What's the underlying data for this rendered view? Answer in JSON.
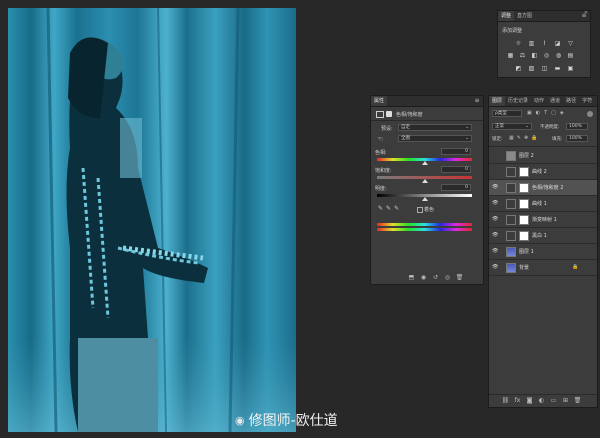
{
  "adjustments_panel": {
    "tabs": [
      "调整",
      "直方图"
    ],
    "subtitle": "添加调整",
    "icons_row1": [
      "brightness-contrast-icon",
      "levels-icon",
      "curves-icon",
      "exposure-icon",
      "vibrance-icon"
    ],
    "icons_row2": [
      "hue-saturation-icon",
      "color-balance-icon",
      "black-white-icon",
      "photo-filter-icon",
      "channel-mixer-icon",
      "color-lookup-icon"
    ],
    "icons_row3": [
      "invert-icon",
      "posterize-icon",
      "threshold-icon",
      "gradient-map-icon",
      "selective-color-icon"
    ]
  },
  "properties_panel": {
    "tab": "属性",
    "title": "色相/饱和度",
    "preset_label": "预设:",
    "preset_value": "自定",
    "channel_value": "全图",
    "hue_label": "色相:",
    "hue_value": "0",
    "hue_level": 0.5,
    "saturation_label": "饱和度:",
    "saturation_value": "0",
    "saturation_level": 0.5,
    "lightness_label": "明度:",
    "lightness_value": "0",
    "lightness_level": 0.5,
    "colorize_label": "着色"
  },
  "layers_panel": {
    "tabs": [
      "图层",
      "历史记录",
      "动作",
      "通道",
      "路径",
      "字符"
    ],
    "filter_kind": "ρ类型",
    "blend_mode": "正常",
    "opacity_label": "不透明度:",
    "opacity_value": "100%",
    "lock_label": "锁定:",
    "fill_label": "填充:",
    "fill_value": "100%",
    "layers": [
      {
        "name": "图层 2",
        "visible": false,
        "kind": "pixel",
        "selected": false
      },
      {
        "name": "曲线 2",
        "visible": false,
        "kind": "adjustment",
        "selected": false
      },
      {
        "name": "色相/饱和度 2",
        "visible": true,
        "kind": "adjustment",
        "selected": true
      },
      {
        "name": "曲线 1",
        "visible": true,
        "kind": "adjustment",
        "selected": false
      },
      {
        "name": "渐变映射 1",
        "visible": true,
        "kind": "adjustment",
        "selected": false
      },
      {
        "name": "黑白 1",
        "visible": true,
        "kind": "adjustment",
        "selected": false
      },
      {
        "name": "图层 1",
        "visible": true,
        "kind": "photo",
        "selected": false
      },
      {
        "name": "背景",
        "visible": true,
        "kind": "photo",
        "selected": false
      }
    ]
  },
  "watermark": "修图师-欧仕道"
}
